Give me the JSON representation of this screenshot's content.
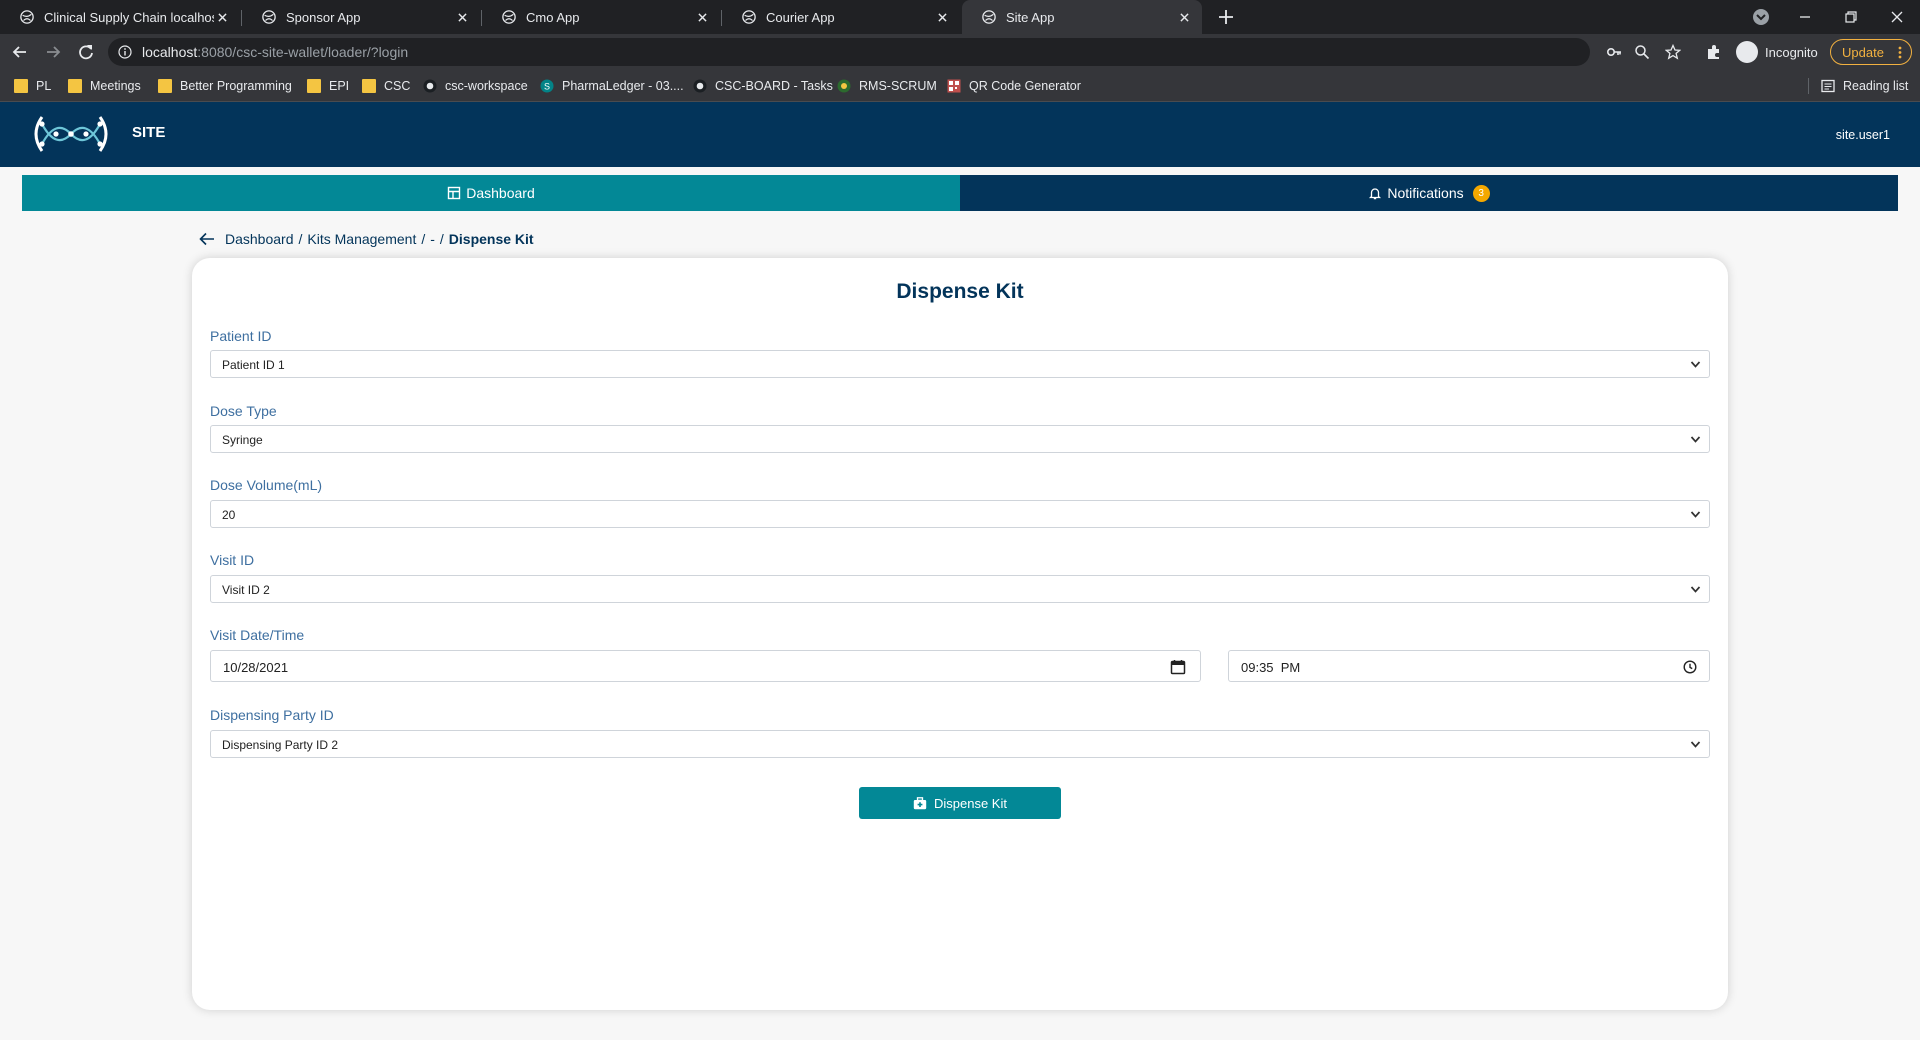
{
  "browser": {
    "tabs": [
      {
        "title": "Clinical Supply Chain localhost",
        "active": false
      },
      {
        "title": "Sponsor App",
        "active": false
      },
      {
        "title": "Cmo App",
        "active": false
      },
      {
        "title": "Courier App",
        "active": false
      },
      {
        "title": "Site App",
        "active": true
      }
    ],
    "url_host": "localhost",
    "url_rest": ":8080/csc-site-wallet/loader/?login",
    "profile_label": "Incognito",
    "update_label": "Update",
    "bookmarks": [
      {
        "label": "PL",
        "icon": "folder-icon"
      },
      {
        "label": "Meetings",
        "icon": "folder-icon"
      },
      {
        "label": "Better Programming",
        "icon": "folder-icon"
      },
      {
        "label": "EPI",
        "icon": "folder-icon"
      },
      {
        "label": "CSC",
        "icon": "folder-icon"
      },
      {
        "label": "csc-workspace",
        "icon": "github-icon"
      },
      {
        "label": "PharmaLedger - 03....",
        "icon": "sharepoint-icon"
      },
      {
        "label": "CSC-BOARD - Tasks",
        "icon": "github-icon"
      },
      {
        "label": "RMS-SCRUM",
        "icon": "jira-icon"
      },
      {
        "label": "QR Code Generator",
        "icon": "qr-icon"
      }
    ],
    "reading_list_label": "Reading list"
  },
  "app": {
    "name": "SITE",
    "user": "site.user1",
    "nav": {
      "dashboard_label": "Dashboard",
      "notifications_label": "Notifications",
      "notifications_count": "3"
    },
    "breadcrumb": {
      "items": [
        "Dashboard",
        "Kits Management",
        "-"
      ],
      "current": "Dispense Kit"
    },
    "form": {
      "title": "Dispense Kit",
      "patient_id": {
        "label": "Patient ID",
        "value": "Patient ID 1"
      },
      "dose_type": {
        "label": "Dose Type",
        "value": "Syringe"
      },
      "dose_volume": {
        "label": "Dose Volume(mL)",
        "value": "20"
      },
      "visit_id": {
        "label": "Visit ID",
        "value": "Visit ID 2"
      },
      "visit_datetime": {
        "label": "Visit Date/Time",
        "date": "10/28/2021",
        "time": "09:35  PM"
      },
      "dispensing_party": {
        "label": "Dispensing Party ID",
        "value": "Dispensing Party ID 2"
      },
      "submit_label": "Dispense Kit"
    }
  },
  "colors": {
    "header_navy": "#03345a",
    "teal_accent": "#038896",
    "badge_amber": "#f4a800",
    "label_blue": "#3e6fa0"
  }
}
